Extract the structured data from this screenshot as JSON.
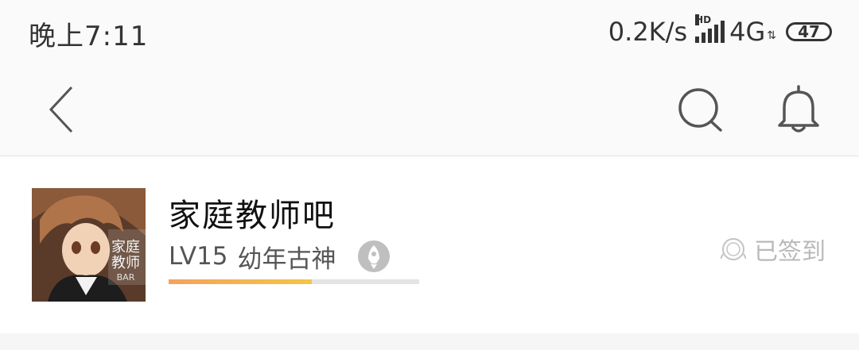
{
  "status_bar": {
    "time": "晚上7:11",
    "net_speed": "0.2K/s",
    "hd_label": "HD",
    "network_type": "4G",
    "battery": "47"
  },
  "forum": {
    "name": "家庭教师吧",
    "level_code": "LV15",
    "level_title": "幼年古神",
    "level_progress": 0.57,
    "signin_label": "已签到",
    "avatar_text_line1": "家庭",
    "avatar_text_line2": "教师",
    "avatar_text_line3": "BAR"
  },
  "colors": {
    "progress_start": "#f5a25d",
    "progress_end": "#f4c542",
    "signin_text": "#b9b9b9"
  }
}
